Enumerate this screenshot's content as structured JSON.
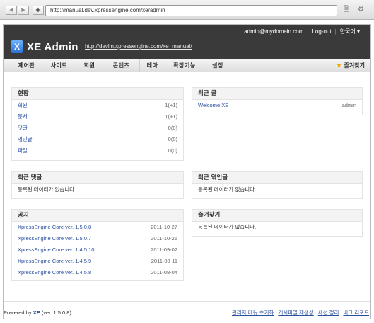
{
  "browser": {
    "url": "http://manual.dev.xpressengine.com/xe/admin",
    "back": "◀",
    "forward": "▶",
    "add": "+"
  },
  "header": {
    "email": "admin@mydomain.com",
    "logout": "Log-out",
    "language": "한국어 ▾",
    "logo_mark": "X",
    "logo_text": "XE Admin",
    "site_url": "http://devlin.xpressengine.com/xe_manual/"
  },
  "menu": {
    "items": [
      "제어판",
      "사이트",
      "회원",
      "콘텐츠",
      "테마",
      "확장기능",
      "설정"
    ],
    "favorite": "즐겨찾기"
  },
  "status": {
    "title": "현황",
    "rows": [
      {
        "label": "회원",
        "value": "1(+1)"
      },
      {
        "label": "문서",
        "value": "1(+1)"
      },
      {
        "label": "댓글",
        "value": "0(0)"
      },
      {
        "label": "엮인글",
        "value": "0(0)"
      },
      {
        "label": "파일",
        "value": "0(0)"
      }
    ]
  },
  "recent_posts": {
    "title": "최근 글",
    "rows": [
      {
        "label": "Welcome XE",
        "value": "admin"
      }
    ]
  },
  "recent_comments": {
    "title": "최근 댓글",
    "empty": "등록된 데이터가 없습니다."
  },
  "recent_trackbacks": {
    "title": "최근 엮인글",
    "empty": "등록된 데이터가 없습니다."
  },
  "notice": {
    "title": "공지",
    "rows": [
      {
        "label": "XpressEngine Core ver. 1.5.0.8",
        "value": "2011-10-27"
      },
      {
        "label": "XpressEngine Core ver. 1.5.0.7",
        "value": "2011-10-26"
      },
      {
        "label": "XpressEngine Core ver. 1.4.5.10",
        "value": "2011-09-02"
      },
      {
        "label": "XpressEngine Core ver. 1.4.5.9",
        "value": "2011-08-11"
      },
      {
        "label": "XpressEngine Core ver. 1.4.5.8",
        "value": "2011-08-04"
      }
    ]
  },
  "favorites": {
    "title": "즐겨찾기",
    "empty": "등록된 데이터가 없습니다."
  },
  "footer": {
    "powered_prefix": "Powered by",
    "powered_brand": "XE",
    "powered_version": "(ver. 1.5.0.8).",
    "links": [
      "관리자 메뉴 초기화",
      "캐시파일 재생성",
      "세션 정리",
      "버그 리포트"
    ]
  }
}
